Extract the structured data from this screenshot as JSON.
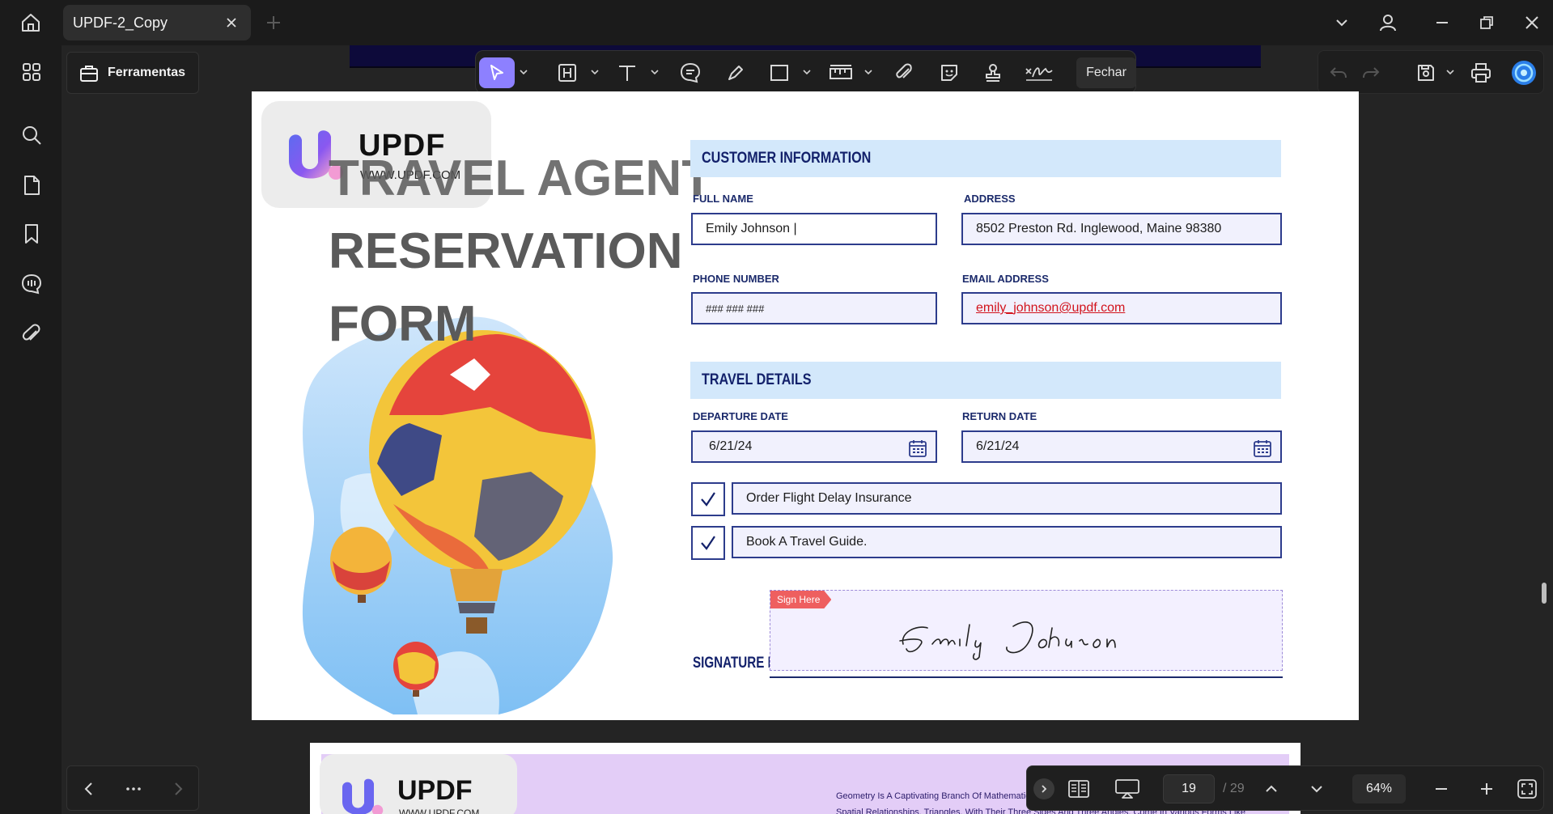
{
  "app": {
    "tab_title": "UPDF-2_Copy",
    "tools_label": "Ferramentas",
    "close_label": "Fechar"
  },
  "document": {
    "logo_brand": "UPDF",
    "logo_url": "WWW.UPDF.COM",
    "title_lines": [
      "TRAVEL AGENT",
      "RESERVATION",
      "FORM"
    ],
    "customer_section": "CUSTOMER INFORMATION",
    "full_name_label": "FULL NAME",
    "full_name_value": "Emily Johnson |",
    "address_label": "ADDRESS",
    "address_value": "8502 Preston Rd. Inglewood, Maine 98380",
    "phone_label": "PHONE NUMBER",
    "phone_value": "### ### ###",
    "email_label": "EMAIL ADDRESS",
    "email_value": "emily_johnson@updf.com",
    "travel_section": "TRAVEL DETAILS",
    "departure_label": "DEPARTURE DATE",
    "departure_value": "6/21/24",
    "return_label": "RETURN DATE",
    "return_value": "6/21/24",
    "option1_label": "Order Flight Delay Insurance",
    "option1_checked": true,
    "option2_label": "Book A Travel Guide.",
    "option2_checked": true,
    "sign_tag": "Sign Here",
    "signature_text": "Emily Johnson",
    "signature_label": "SIGNATURE L"
  },
  "next_page": {
    "logo_brand": "UPDF",
    "logo_url": "WWW.UPDF.COM",
    "text_line1": "Geometry Is A Captivating Branch Of Mathematic",
    "text_line2": "Spatial Relationships. Triangles, With Their Three Sides And Three Angles, Come In Various Forms Like"
  },
  "pagination": {
    "current_page": "19",
    "total_pages": "/ 29",
    "zoom": "64%"
  },
  "colors": {
    "accent": "#8d80ff",
    "form_navy": "#13216b",
    "section_band": "#d3e8fb"
  },
  "icons": {
    "sidebar": [
      "thumbnails-icon",
      "search-icon",
      "page-icon",
      "bookmark-icon",
      "comment-icon",
      "attachment-icon"
    ],
    "toolbar": [
      "select-icon",
      "highlight-icon",
      "text-icon",
      "comment-icon",
      "pen-icon",
      "shape-icon",
      "measure-icon",
      "attach-icon",
      "sticker-icon",
      "stamp-icon",
      "signature-icon"
    ]
  }
}
